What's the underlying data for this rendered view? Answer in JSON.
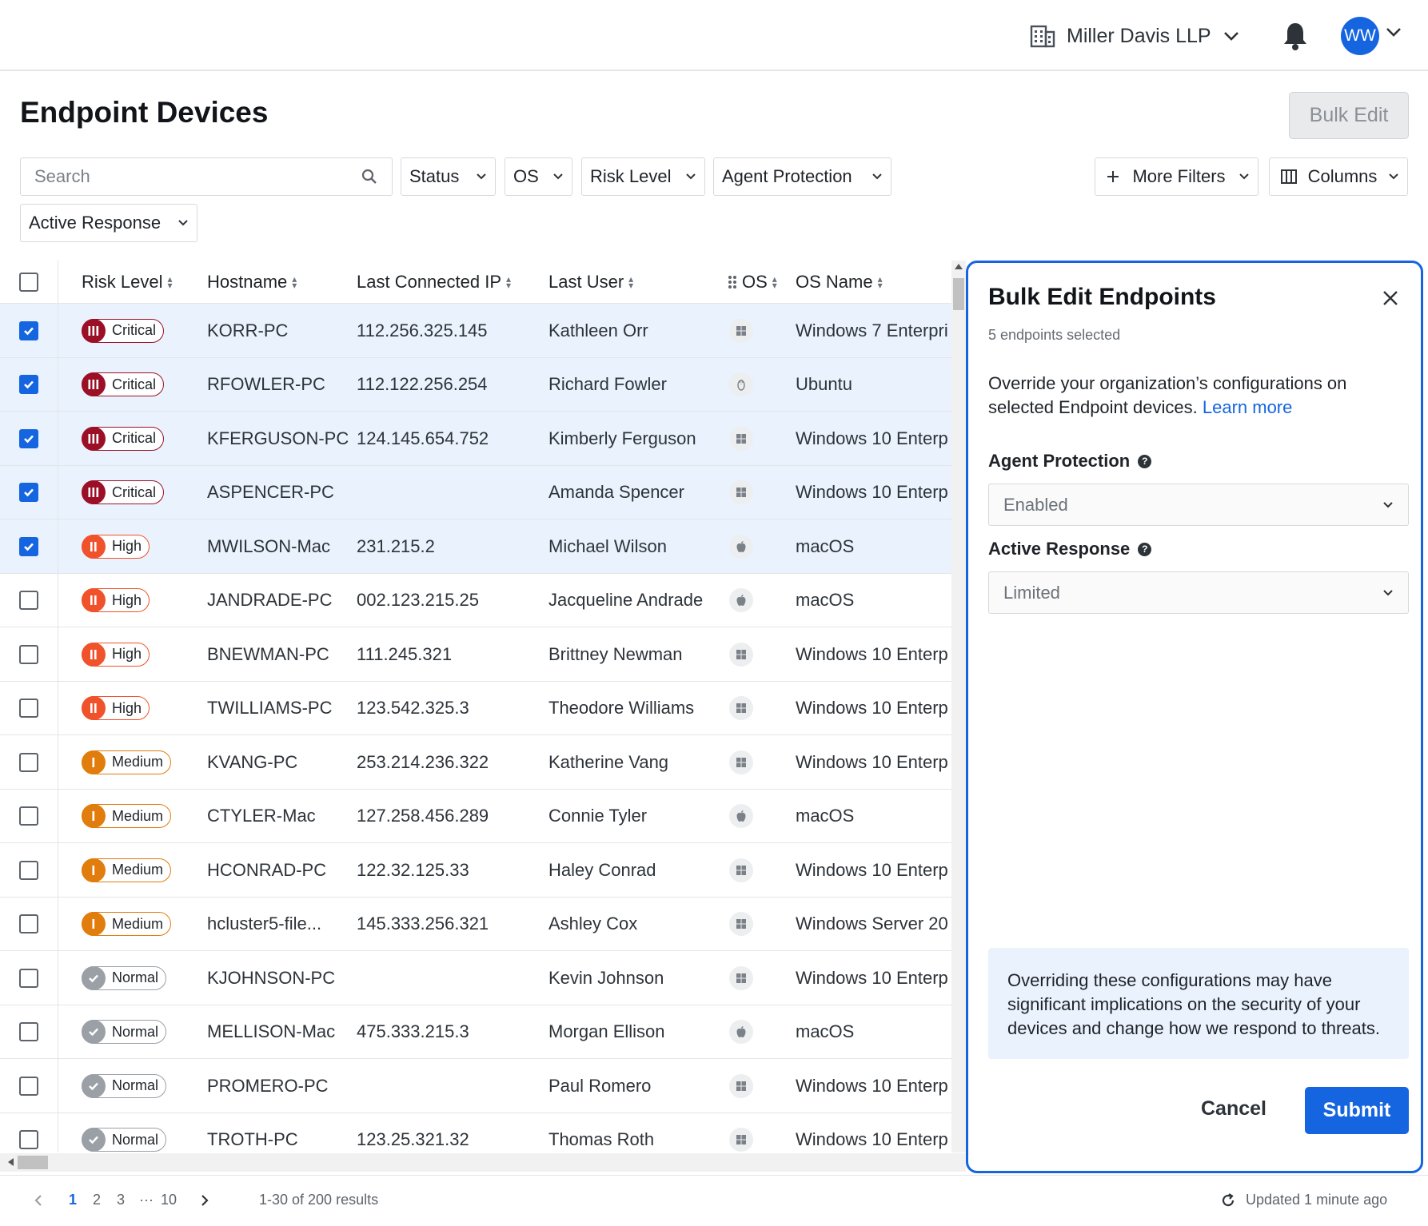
{
  "header": {
    "org_name": "Miller Davis LLP",
    "avatar_initials": "WW"
  },
  "page": {
    "title": "Endpoint Devices",
    "bulk_edit_label": "Bulk Edit"
  },
  "filters": {
    "search_placeholder": "Search",
    "status": "Status",
    "os": "OS",
    "risk_level": "Risk Level",
    "agent_protection": "Agent Protection",
    "active_response": "Active Response",
    "more_filters": "More Filters",
    "columns": "Columns"
  },
  "table": {
    "columns": {
      "risk_level": "Risk Level",
      "hostname": "Hostname",
      "ip": "Last Connected IP",
      "user": "Last User",
      "os": "OS",
      "os_name": "OS Name"
    },
    "rows": [
      {
        "selected": true,
        "risk": "Critical",
        "hostname": "KORR-PC",
        "ip": "112.256.325.145",
        "user": "Kathleen Orr",
        "os": "windows",
        "os_name": "Windows 7 Enterpri"
      },
      {
        "selected": true,
        "risk": "Critical",
        "hostname": "RFOWLER-PC",
        "ip": "112.122.256.254",
        "user": "Richard Fowler",
        "os": "linux",
        "os_name": "Ubuntu"
      },
      {
        "selected": true,
        "risk": "Critical",
        "hostname": "KFERGUSON-PC",
        "ip": "124.145.654.752",
        "user": "Kimberly Ferguson",
        "os": "windows",
        "os_name": "Windows 10 Enterp"
      },
      {
        "selected": true,
        "risk": "Critical",
        "hostname": "ASPENCER-PC",
        "ip": "",
        "user": "Amanda Spencer",
        "os": "windows",
        "os_name": "Windows 10 Enterp"
      },
      {
        "selected": true,
        "risk": "High",
        "hostname": "MWILSON-Mac",
        "ip": "231.215.2",
        "user": "Michael Wilson",
        "os": "apple",
        "os_name": "macOS"
      },
      {
        "selected": false,
        "risk": "High",
        "hostname": "JANDRADE-PC",
        "ip": "002.123.215.25",
        "user": "Jacqueline Andrade",
        "os": "apple",
        "os_name": "macOS"
      },
      {
        "selected": false,
        "risk": "High",
        "hostname": "BNEWMAN-PC",
        "ip": "111.245.321",
        "user": "Brittney Newman",
        "os": "windows",
        "os_name": "Windows 10 Enterp"
      },
      {
        "selected": false,
        "risk": "High",
        "hostname": "TWILLIAMS-PC",
        "ip": "123.542.325.3",
        "user": "Theodore Williams",
        "os": "windows",
        "os_name": "Windows 10 Enterp"
      },
      {
        "selected": false,
        "risk": "Medium",
        "hostname": "KVANG-PC",
        "ip": "253.214.236.322",
        "user": "Katherine Vang",
        "os": "windows",
        "os_name": "Windows 10 Enterp"
      },
      {
        "selected": false,
        "risk": "Medium",
        "hostname": "CTYLER-Mac",
        "ip": "127.258.456.289",
        "user": "Connie Tyler",
        "os": "apple",
        "os_name": "macOS"
      },
      {
        "selected": false,
        "risk": "Medium",
        "hostname": "HCONRAD-PC",
        "ip": "122.32.125.33",
        "user": "Haley Conrad",
        "os": "windows",
        "os_name": "Windows 10 Enterp"
      },
      {
        "selected": false,
        "risk": "Medium",
        "hostname": "hcluster5-file...",
        "ip": "145.333.256.321",
        "user": "Ashley Cox",
        "os": "windows",
        "os_name": "Windows Server 20"
      },
      {
        "selected": false,
        "risk": "Normal",
        "hostname": "KJOHNSON-PC",
        "ip": "",
        "user": "Kevin Johnson",
        "os": "windows",
        "os_name": "Windows 10 Enterp"
      },
      {
        "selected": false,
        "risk": "Normal",
        "hostname": "MELLISON-Mac",
        "ip": "475.333.215.3",
        "user": "Morgan Ellison",
        "os": "apple",
        "os_name": "macOS"
      },
      {
        "selected": false,
        "risk": "Normal",
        "hostname": "PROMERO-PC",
        "ip": "",
        "user": "Paul Romero",
        "os": "windows",
        "os_name": "Windows 10 Enterp"
      },
      {
        "selected": false,
        "risk": "Normal",
        "hostname": "TROTH-PC",
        "ip": "123.25.321.32",
        "user": "Thomas Roth",
        "os": "windows",
        "os_name": "Windows 10 Enterp"
      }
    ]
  },
  "risk_colors": {
    "Critical": "#9b1027",
    "High": "#f0522b",
    "Medium": "#e07d0c",
    "Normal": "#9aa0a6"
  },
  "panel": {
    "title": "Bulk Edit Endpoints",
    "selected_count": "5 endpoints selected",
    "description": "Override your organization’s configurations on selected Endpoint devices.",
    "learn_more": "Learn more",
    "agent_protection_label": "Agent Protection",
    "agent_protection_value": "Enabled",
    "active_response_label": "Active Response",
    "active_response_value": "Limited",
    "warning": "Overriding these configurations may have significant implications on the security of your devices and change how we respond to threats.",
    "cancel": "Cancel",
    "submit": "Submit"
  },
  "pagination": {
    "pages": [
      "1",
      "2",
      "3",
      "···",
      "10"
    ],
    "current": "1",
    "results": "1-30 of 200 results",
    "updated": "Updated 1 minute ago"
  },
  "accent_color": "#1565e0"
}
